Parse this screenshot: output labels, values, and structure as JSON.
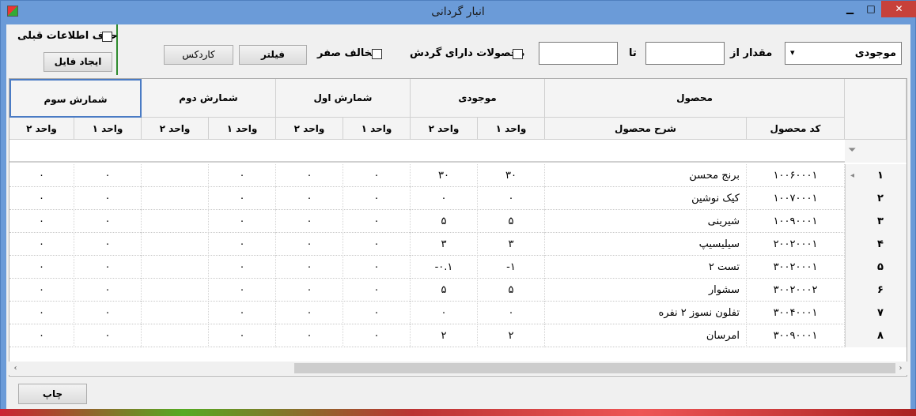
{
  "window": {
    "title": "انبار گردانی",
    "min_label": "▁",
    "max_label": "□",
    "close_label": "✕"
  },
  "toolbar": {
    "delete_prev_label": "حذف اطلاعات قبلی",
    "create_file_label": "ایجاد فایل",
    "kardex_label": "کاردکس",
    "filter_label": "فیلتر",
    "nonzero_label": "مخالف صفر",
    "circulating_label": "محصولات دارای گردش",
    "to_label": "تا",
    "amount_from_label": "مقدار از",
    "combo_value": "موجودی",
    "from_value": "",
    "to_value": ""
  },
  "grid": {
    "group_headers": [
      "محصول",
      "موجودی",
      "شمارش اول",
      "شمارش دوم",
      "شمارش سوم"
    ],
    "sub_headers": {
      "product_code": "کد محصول",
      "product_desc": "شرح محصول",
      "unit1": "واحد ۱",
      "unit2": "واحد ۲"
    },
    "filter_icon": "filter-icon",
    "rows": [
      {
        "n": "۱",
        "code": "۱۰۰۶۰۰۰۱",
        "desc": "برنج محسن",
        "inv1": "۳۰",
        "inv2": "۳۰",
        "c1u1": "۰",
        "c1u2": "۰",
        "c2u1": "۰",
        "c2u2": "",
        "c3u1": "۰",
        "c3u2": "۰"
      },
      {
        "n": "۲",
        "code": "۱۰۰۷۰۰۰۱",
        "desc": "کیک نوشین",
        "inv1": "۰",
        "inv2": "۰",
        "c1u1": "۰",
        "c1u2": "۰",
        "c2u1": "۰",
        "c2u2": "",
        "c3u1": "۰",
        "c3u2": "۰"
      },
      {
        "n": "۳",
        "code": "۱۰۰۹۰۰۰۱",
        "desc": "شیرینی",
        "inv1": "۵",
        "inv2": "۵",
        "c1u1": "۰",
        "c1u2": "۰",
        "c2u1": "۰",
        "c2u2": "",
        "c3u1": "۰",
        "c3u2": "۰"
      },
      {
        "n": "۴",
        "code": "۲۰۰۲۰۰۰۱",
        "desc": "سیلیسیپ",
        "inv1": "۳",
        "inv2": "۳",
        "c1u1": "۰",
        "c1u2": "۰",
        "c2u1": "۰",
        "c2u2": "",
        "c3u1": "۰",
        "c3u2": "۰"
      },
      {
        "n": "۵",
        "code": "۳۰۰۲۰۰۰۱",
        "desc": "تست ۲",
        "inv1": "-۱",
        "inv2": "-۰.۱",
        "c1u1": "۰",
        "c1u2": "۰",
        "c2u1": "۰",
        "c2u2": "",
        "c3u1": "۰",
        "c3u2": "۰"
      },
      {
        "n": "۶",
        "code": "۳۰۰۲۰۰۰۲",
        "desc": "سشوار",
        "inv1": "۵",
        "inv2": "۵",
        "c1u1": "۰",
        "c1u2": "۰",
        "c2u1": "۰",
        "c2u2": "",
        "c3u1": "۰",
        "c3u2": "۰"
      },
      {
        "n": "۷",
        "code": "۳۰۰۴۰۰۰۱",
        "desc": "تفلون نسوز ۲ نفره",
        "inv1": "۰",
        "inv2": "۰",
        "c1u1": "۰",
        "c1u2": "۰",
        "c2u1": "۰",
        "c2u2": "",
        "c3u1": "۰",
        "c3u2": "۰"
      },
      {
        "n": "۸",
        "code": "۳۰۰۹۰۰۰۱",
        "desc": "امرسان",
        "inv1": "۲",
        "inv2": "۲",
        "c1u1": "۰",
        "c1u2": "۰",
        "c2u1": "۰",
        "c2u2": "",
        "c3u1": "۰",
        "c3u2": "۰"
      }
    ]
  },
  "footer": {
    "print_label": "چاپ"
  }
}
